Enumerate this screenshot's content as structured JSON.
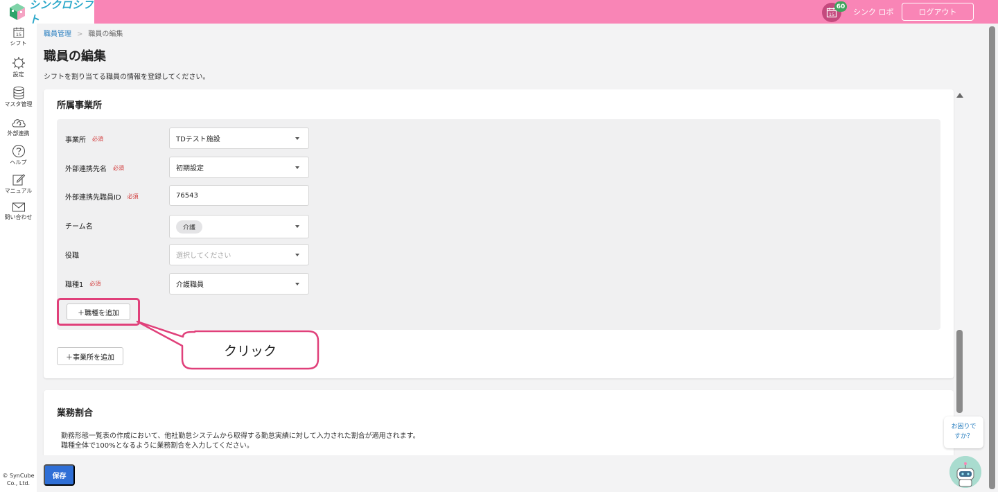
{
  "header": {
    "logo_text": "シンクロシフト",
    "notification_count": "60",
    "calendar_icon_day": "15",
    "user_name": "シンク ロボ",
    "logout_label": "ログアウト",
    "bg_color": "#f985b6"
  },
  "sidebar": {
    "items": [
      {
        "label": "シフト",
        "icon": "calendar-icon",
        "icon_text": "15"
      },
      {
        "label": "設定",
        "icon": "gear-icon"
      },
      {
        "label": "マスタ管理",
        "icon": "database-icon"
      },
      {
        "label": "外部連携",
        "icon": "cloud-sync-icon"
      },
      {
        "label": "ヘルプ",
        "icon": "question-icon"
      },
      {
        "label": "マニュアル",
        "icon": "edit-icon"
      },
      {
        "label": "問い合わせ",
        "icon": "mail-icon"
      }
    ],
    "copyright_line1": "© SynCube",
    "copyright_line2": "Co., Ltd."
  },
  "breadcrumb": {
    "parent": "職員管理",
    "separator": ">",
    "current": "職員の編集"
  },
  "page": {
    "title": "職員の編集",
    "description": "シフトを割り当てる職員の情報を登録してください。"
  },
  "office_section": {
    "title": "所属事業所",
    "required_label": "必須",
    "fields": [
      {
        "label": "事業所",
        "required": true,
        "value": "TDテスト施設",
        "type": "select"
      },
      {
        "label": "外部連携先名",
        "required": true,
        "value": "初期設定",
        "type": "select"
      },
      {
        "label": "外部連携先職員ID",
        "required": true,
        "value": "76543",
        "type": "text"
      },
      {
        "label": "チーム名",
        "required": false,
        "value": "介護",
        "type": "chip-select"
      },
      {
        "label": "役職",
        "required": false,
        "value": "",
        "placeholder": "選択してください",
        "type": "select"
      },
      {
        "label": "職種1",
        "required": true,
        "value": "介護職員",
        "type": "select"
      }
    ],
    "add_job_type_label": "＋職種を追加",
    "add_office_label": "＋事業所を追加"
  },
  "callout": {
    "text": "クリック",
    "color": "#e0407a"
  },
  "work_ratio_section": {
    "title": "業務割合",
    "line1": "勤務形態一覧表の作成において、他社勤怠システムから取得する勤怠実績に対して入力された割合が適用されます。",
    "line2": "職種全体で100%となるように業務割合を入力してください。"
  },
  "footer": {
    "save_label": "保存",
    "save_color": "#2f6fd6"
  },
  "help_widget": {
    "line1": "お困りで",
    "line2": "すか？"
  }
}
